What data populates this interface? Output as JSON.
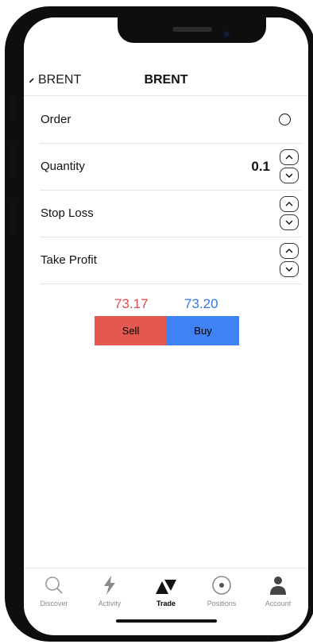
{
  "header": {
    "back_label": "BRENT",
    "title": "BRENT"
  },
  "form": {
    "order_label": "Order",
    "quantity_label": "Quantity",
    "quantity_value": "0.1",
    "stop_loss_label": "Stop Loss",
    "take_profit_label": "Take Profit"
  },
  "prices": {
    "sell_price": "73.17",
    "buy_price": "73.20",
    "sell_label": "Sell",
    "buy_label": "Buy",
    "sell_color": "#e4594f",
    "buy_color": "#3f82f4"
  },
  "tabs": [
    {
      "label": "Discover",
      "icon": "search-icon"
    },
    {
      "label": "Activity",
      "icon": "lightning-icon"
    },
    {
      "label": "Trade",
      "icon": "trade-icon",
      "active": true
    },
    {
      "label": "Positions",
      "icon": "target-icon"
    },
    {
      "label": "Account",
      "icon": "person-icon"
    }
  ]
}
